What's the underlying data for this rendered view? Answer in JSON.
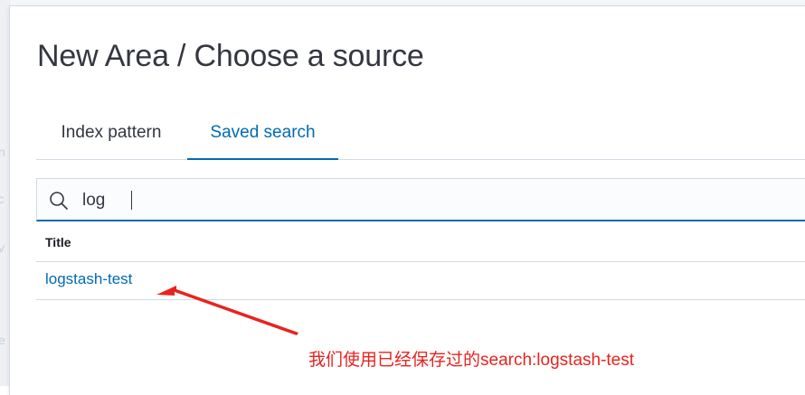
{
  "modal": {
    "title": "New Area / Choose a source"
  },
  "tabs": [
    {
      "label": "Index pattern",
      "selected": false
    },
    {
      "label": "Saved search",
      "selected": true
    }
  ],
  "search": {
    "value": "log",
    "icon": "search-icon"
  },
  "table": {
    "columns": [
      "Title"
    ],
    "rows": [
      {
        "title": "logstash-test"
      }
    ]
  },
  "annotation": {
    "text": "我们使用已经保存过的search:logstash-test",
    "color": "#e8231f"
  },
  "colors": {
    "accent": "#006bb4",
    "text": "#343741",
    "border": "#d3dae6"
  }
}
